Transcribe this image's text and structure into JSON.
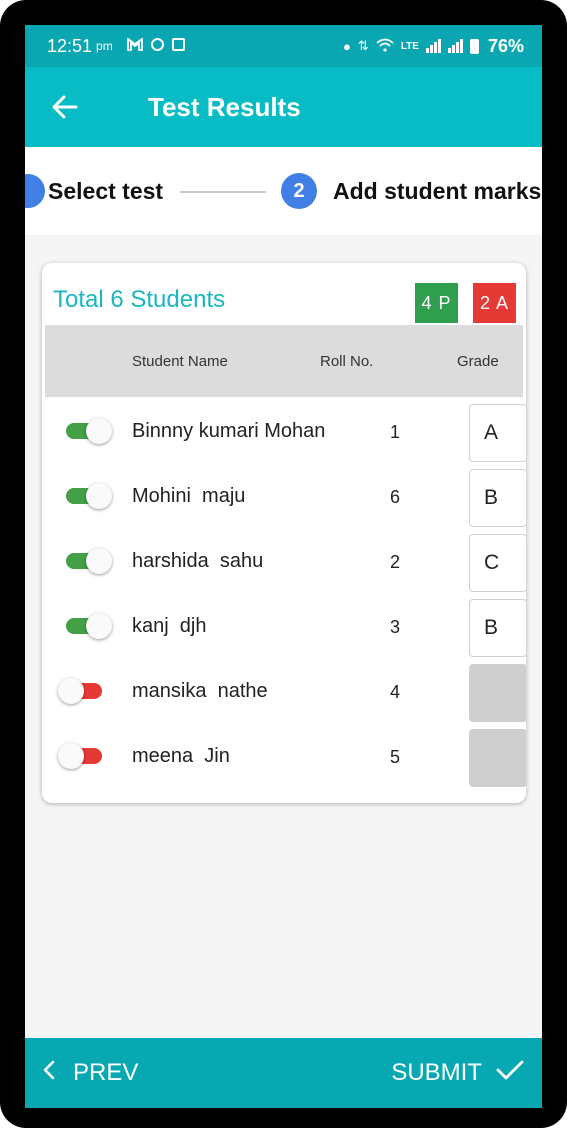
{
  "status_bar": {
    "time": "12:51",
    "ampm": "pm",
    "battery": "76%",
    "icons_left": [
      "gmail-icon",
      "sync-icon",
      "linkedin-icon"
    ],
    "icons_right": [
      "dot-icon",
      "data-arrows-icon",
      "wifi-icon",
      "volte-icon",
      "signal-icon",
      "signal-icon",
      "battery-icon"
    ]
  },
  "app_bar": {
    "title": "Test Results",
    "back_icon": "arrow-left-icon"
  },
  "stepper": {
    "step1_label": "Select test",
    "step2_number": "2",
    "step2_label": "Add student marks"
  },
  "card": {
    "title": "Total 6 Students",
    "present_badge": "4 P",
    "absent_badge": "2 A",
    "headers": {
      "name": "Student Name",
      "roll": "Roll No.",
      "grade": "Grade"
    },
    "rows": [
      {
        "name": "Binnny kumari Mohan",
        "roll": "1",
        "grade": "A",
        "present": true
      },
      {
        "name": "Mohini  maju",
        "roll": "6",
        "grade": "B",
        "present": true
      },
      {
        "name": "harshida  sahu",
        "roll": "2",
        "grade": "C",
        "present": true
      },
      {
        "name": "kanj  djh",
        "roll": "3",
        "grade": "B",
        "present": true
      },
      {
        "name": "mansika  nathe",
        "roll": "4",
        "grade": "",
        "present": false
      },
      {
        "name": "meena  Jin",
        "roll": "5",
        "grade": "",
        "present": false
      }
    ]
  },
  "bottom_bar": {
    "prev_label": "PREV",
    "submit_label": "SUBMIT"
  },
  "colors": {
    "app_bar": "#08bcc5",
    "status_bar": "#0aa7b2",
    "accent_blue": "#3f7fe6",
    "present_green": "#2f9e4f",
    "absent_red": "#e53935",
    "title_teal": "#19b6c0"
  }
}
